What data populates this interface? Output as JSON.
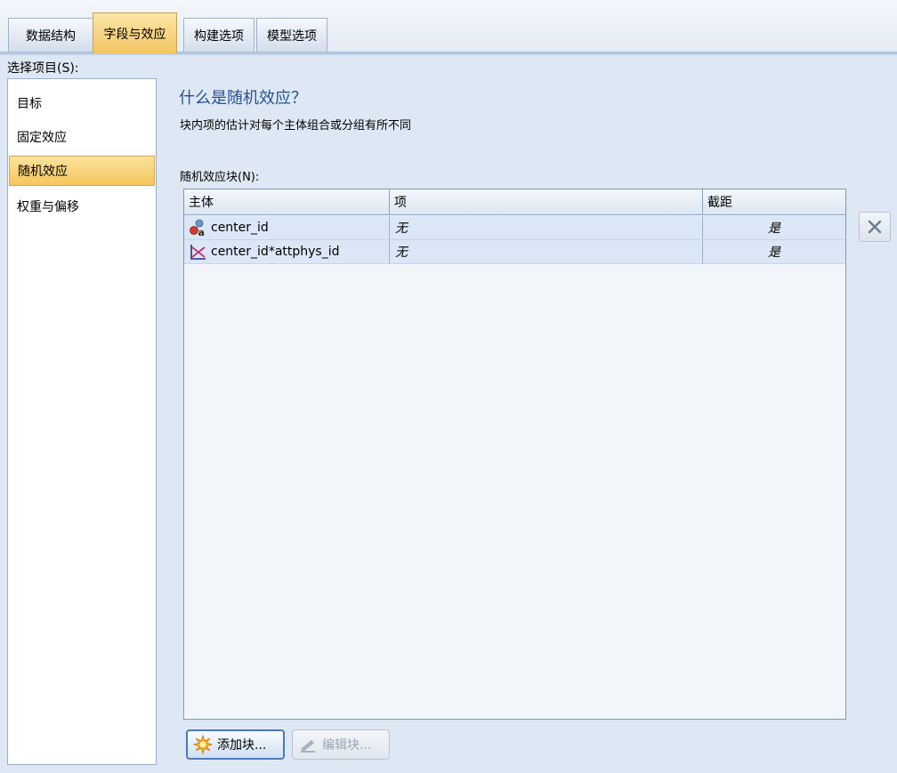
{
  "tabs": [
    {
      "label": "数据结构"
    },
    {
      "label": "字段与效应",
      "active": true
    },
    {
      "label": "构建选项"
    },
    {
      "label": "模型选项"
    }
  ],
  "sidebar": {
    "label": "选择项目(S):",
    "items": [
      {
        "label": "目标"
      },
      {
        "label": "固定效应"
      },
      {
        "label": "随机效应",
        "selected": true
      },
      {
        "label": "权重与偏移"
      }
    ]
  },
  "main": {
    "title": "什么是随机效应？",
    "description": "块内项的估计对每个主体组合或分组有所不同",
    "block_label": "随机效应块(N):"
  },
  "table": {
    "columns": [
      "主体",
      "项",
      "截距"
    ],
    "rows": [
      {
        "subject": "center_id",
        "term": "无",
        "intercept": "是",
        "icon": "nominal-field-icon"
      },
      {
        "subject": "center_id*attphys_id",
        "term": "无",
        "intercept": "是",
        "icon": "interaction-icon"
      }
    ]
  },
  "buttons": {
    "delete_icon": "close-icon",
    "add_label": "添加块...",
    "edit_label": "编辑块..."
  },
  "colors": {
    "accent": "#2a4f8f",
    "selected": "#f5c65c",
    "background": "#dde8f4"
  }
}
